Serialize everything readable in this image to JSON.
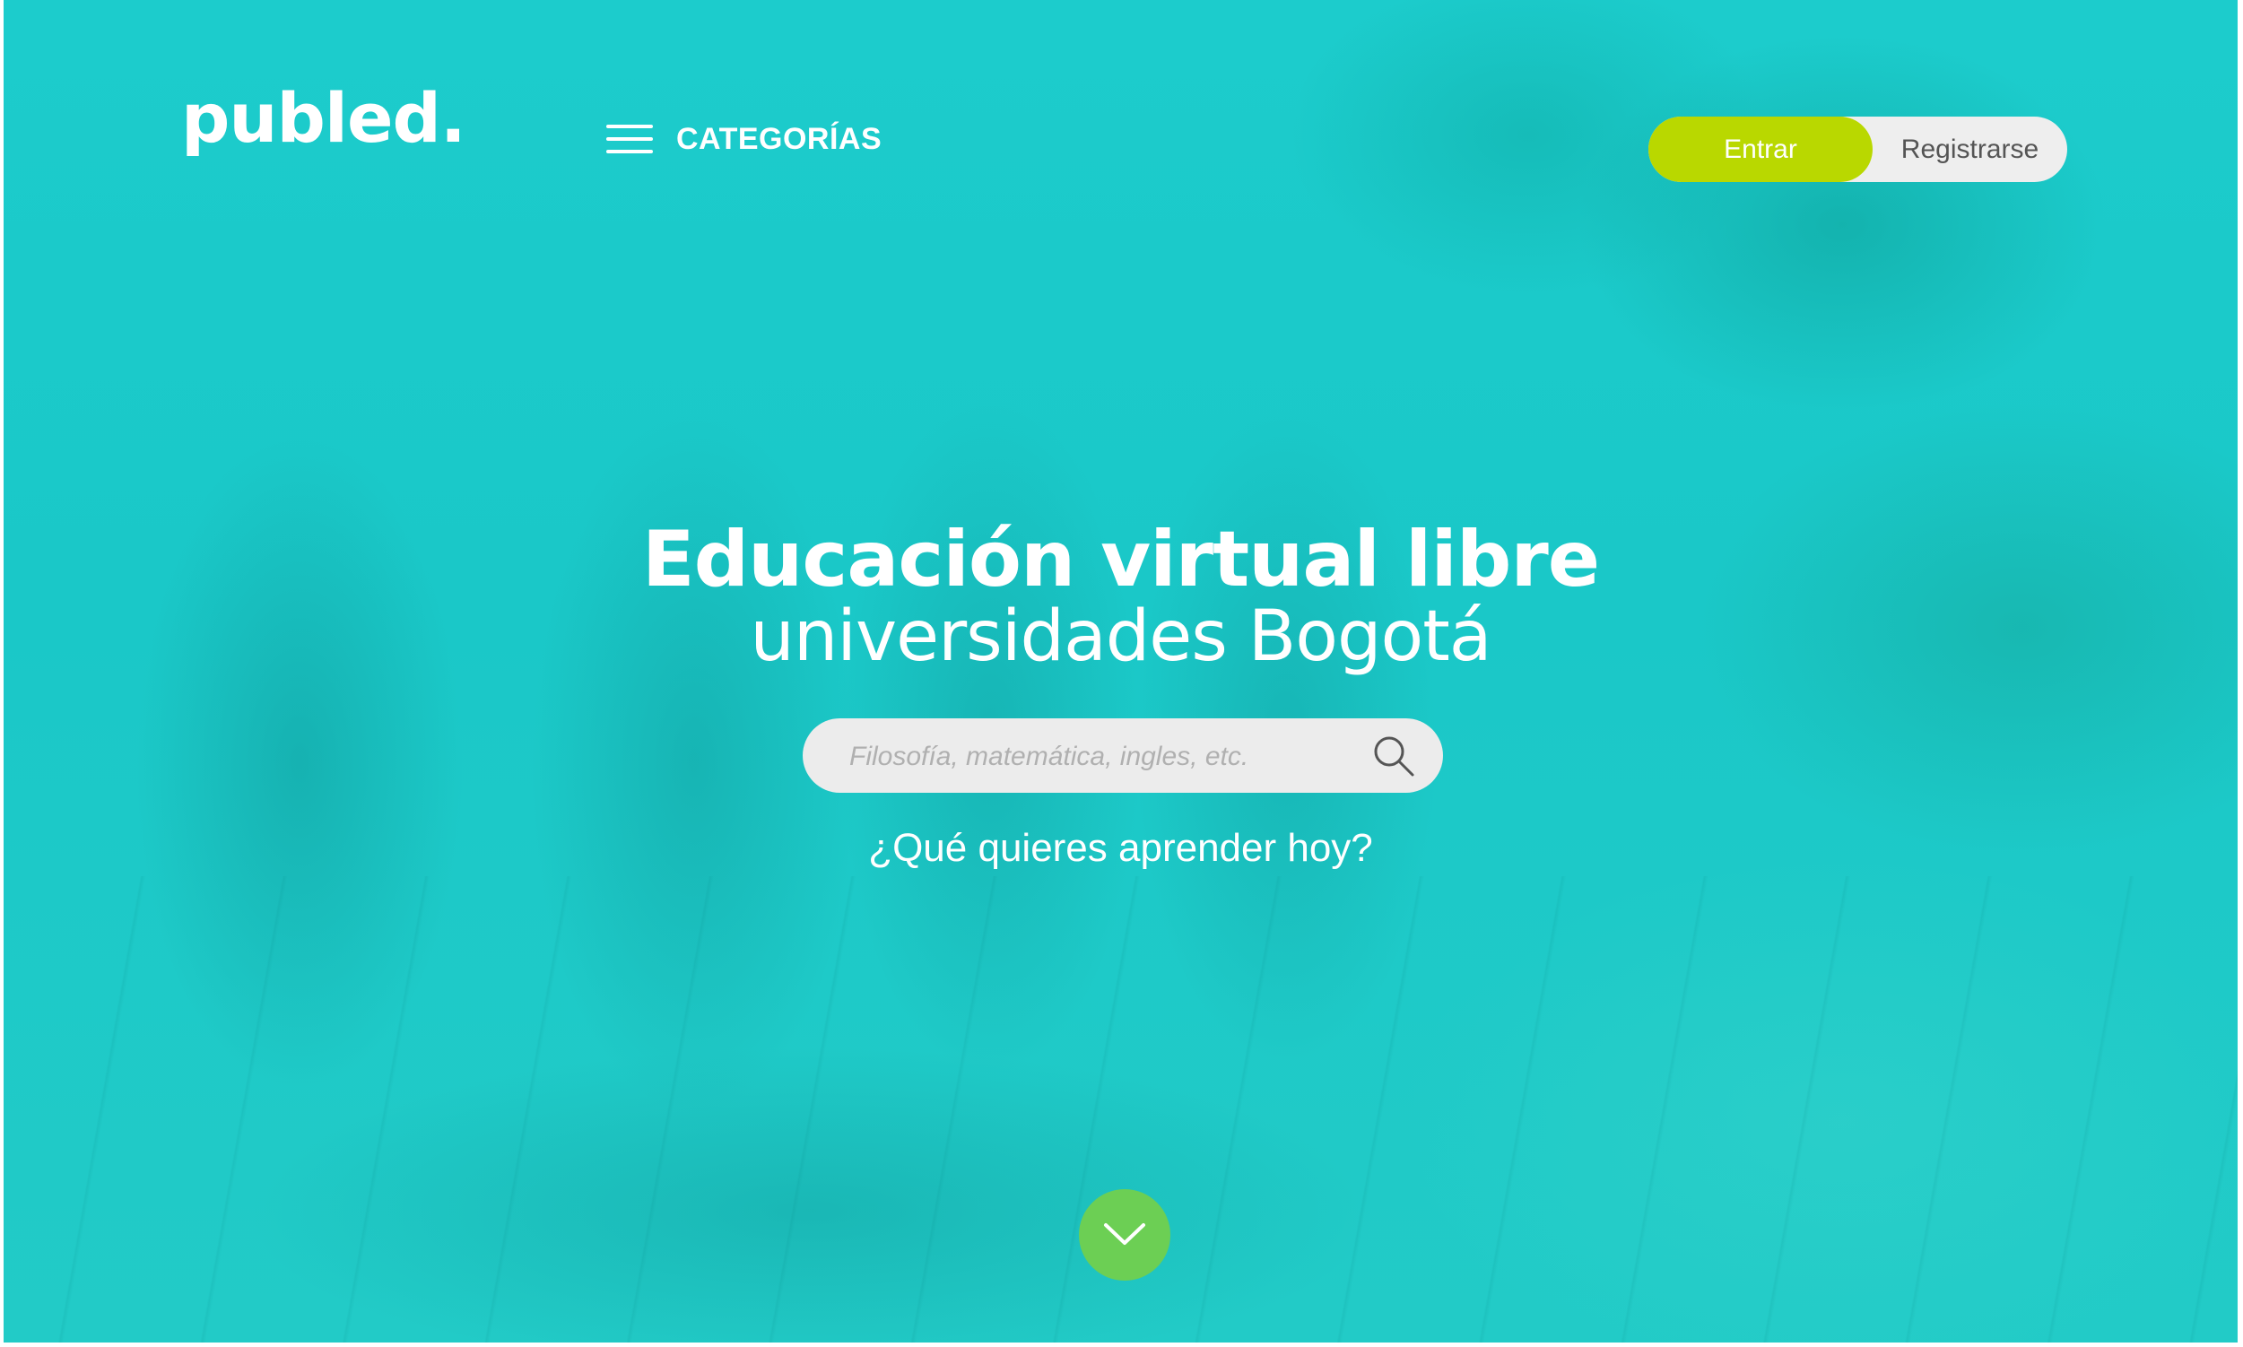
{
  "brand": {
    "logo_text": "publed."
  },
  "nav": {
    "categories_label": "CATEGORÍAS",
    "menu_icon": "hamburger-menu-icon"
  },
  "auth": {
    "login_label": "Entrar",
    "register_label": "Registrarse",
    "login_color": "#b9d800"
  },
  "hero": {
    "title": "Educación virtual libre",
    "subtitle": "universidades Bogotá",
    "question": "¿Qué quieres aprender hoy?"
  },
  "search": {
    "placeholder": "Filosofía, matemática, ingles, etc.",
    "value": "",
    "icon": "search-icon"
  },
  "scroll": {
    "icon": "chevron-down-icon",
    "color": "#6ccf54"
  },
  "colors": {
    "background": "#1ccaca",
    "accent": "#b9d800"
  }
}
